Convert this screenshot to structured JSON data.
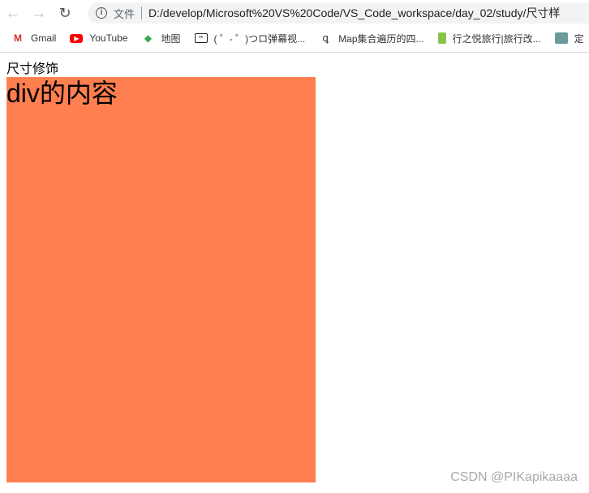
{
  "browser": {
    "url": "D:/develop/Microsoft%20VS%20Code/VS_Code_workspace/day_02/study/尺寸样",
    "security_label": "文件",
    "bookmarks": [
      {
        "label": "Gmail",
        "icon": "gmail-icon"
      },
      {
        "label": "YouTube",
        "icon": "youtube-icon"
      },
      {
        "label": "地图",
        "icon": "maps-icon"
      },
      {
        "label": "( ゜- ゜)つロ弹幕视...",
        "icon": "bilibili-icon"
      },
      {
        "label": "Map集合遍历的四...",
        "icon": "bookmark-icon"
      },
      {
        "label": "行之悦旅行|旅行改...",
        "icon": "bookmark-icon"
      },
      {
        "label": "定",
        "icon": "bookmark-icon"
      }
    ]
  },
  "page": {
    "heading": "尺寸修饰",
    "div_text": "div的内容",
    "div_color": "#ff7f50"
  },
  "watermark": "CSDN @PIKapikaaaa"
}
